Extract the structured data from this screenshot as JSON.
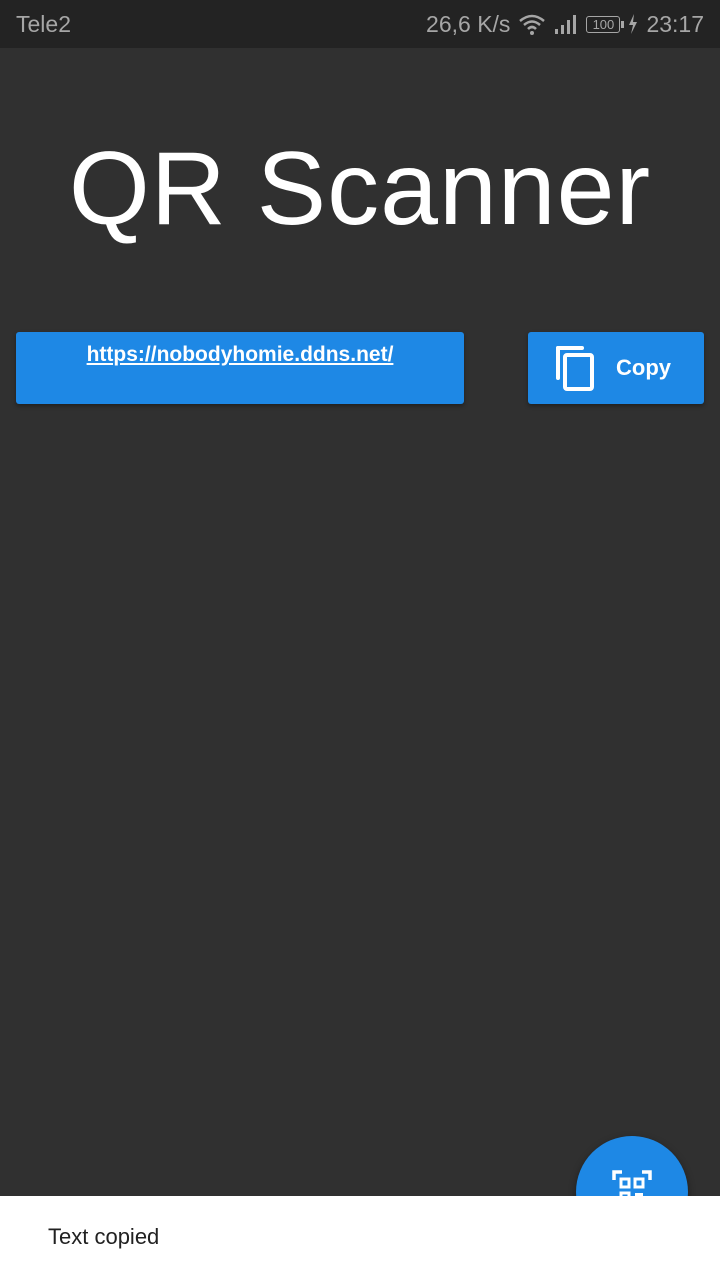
{
  "status_bar": {
    "carrier": "Tele2",
    "speed": "26,6 K/s",
    "battery": "100",
    "time": "23:17"
  },
  "app": {
    "title": "QR Scanner"
  },
  "result": {
    "url": "https://nobodyhomie.ddns.net/",
    "copy_label": "Copy"
  },
  "snackbar": {
    "message": "Text copied"
  },
  "colors": {
    "background": "#303030",
    "status_bar": "#232323",
    "accent": "#1e88e5",
    "snackbar": "#ffffff"
  },
  "icons": {
    "wifi": "wifi-icon",
    "signal": "signal-icon",
    "battery": "battery-icon",
    "charging": "charging-icon",
    "copy": "copy-icon",
    "scan": "qr-scan-icon"
  }
}
